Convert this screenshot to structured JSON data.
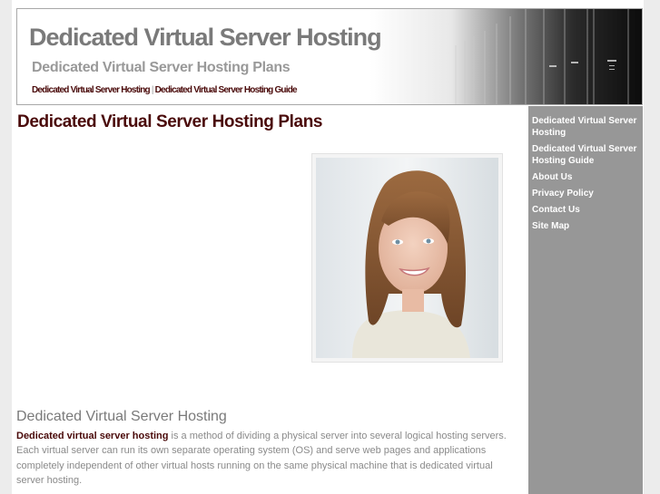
{
  "header": {
    "title": "Dedicated Virtual Server Hosting",
    "subtitle": "Dedicated Virtual Server Hosting Plans",
    "nav": [
      {
        "label": "Dedicated Virtual Server Hosting"
      },
      {
        "label": "Dedicated Virtual Server Hosting Guide"
      }
    ],
    "nav_separator": "|",
    "image": "server-racks-image"
  },
  "main": {
    "page_title": "Dedicated Virtual Server Hosting Plans",
    "photo": "smiling-woman-photo",
    "section": {
      "heading": "Dedicated Virtual Server Hosting",
      "lead_bold": "Dedicated virtual server hosting",
      "body": " is a method of dividing a physical server into several logical hosting servers. Each virtual server can run its own separate operating system (OS) and serve web pages and applications completely independent of other virtual hosts running on the same physical machine that is dedicated virtual server hosting."
    }
  },
  "sidebar": {
    "items": [
      {
        "label": "Dedicated Virtual Server Hosting"
      },
      {
        "label": "Dedicated Virtual Server Hosting Guide"
      },
      {
        "label": "About Us"
      },
      {
        "label": "Privacy Policy"
      },
      {
        "label": "Contact Us"
      },
      {
        "label": "Site Map"
      }
    ]
  },
  "colors": {
    "accent": "#4a0a0a",
    "sidebar_bg": "#979797",
    "page_bg": "#ececec",
    "title_gray": "#7a7a7a"
  }
}
